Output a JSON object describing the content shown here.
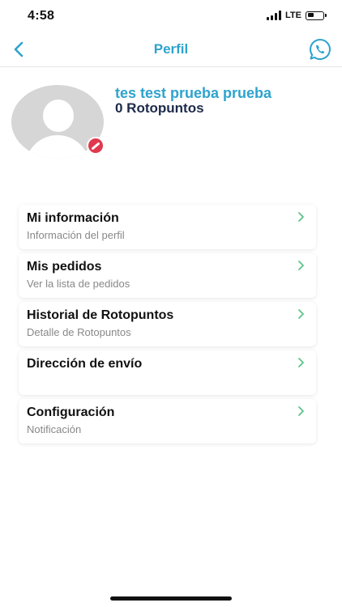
{
  "status_bar": {
    "time": "4:58",
    "carrier": "LTE",
    "battery_level": 0.45
  },
  "nav": {
    "title": "Perfil",
    "back_icon": "chevron-left-icon",
    "action_icon": "whatsapp-icon"
  },
  "profile": {
    "name": "tes test prueba prueba",
    "points": "0 Rotopuntos",
    "avatar_icon": "default-user-avatar",
    "badge_icon": "edit-badge-icon"
  },
  "menu": {
    "items": [
      {
        "title": "Mi información",
        "subtitle": "Información del perfil"
      },
      {
        "title": "Mis pedidos",
        "subtitle": "Ver la lista de pedidos"
      },
      {
        "title": "Historial de Rotopuntos",
        "subtitle": "Detalle de Rotopuntos"
      },
      {
        "title": "Dirección de envío",
        "subtitle": ""
      },
      {
        "title": "Configuración",
        "subtitle": "Notificación"
      }
    ]
  },
  "colors": {
    "accent": "#2ea3cd",
    "chevron": "#5cc48a",
    "points_text": "#1d2a4a",
    "badge": "#e0394f"
  }
}
